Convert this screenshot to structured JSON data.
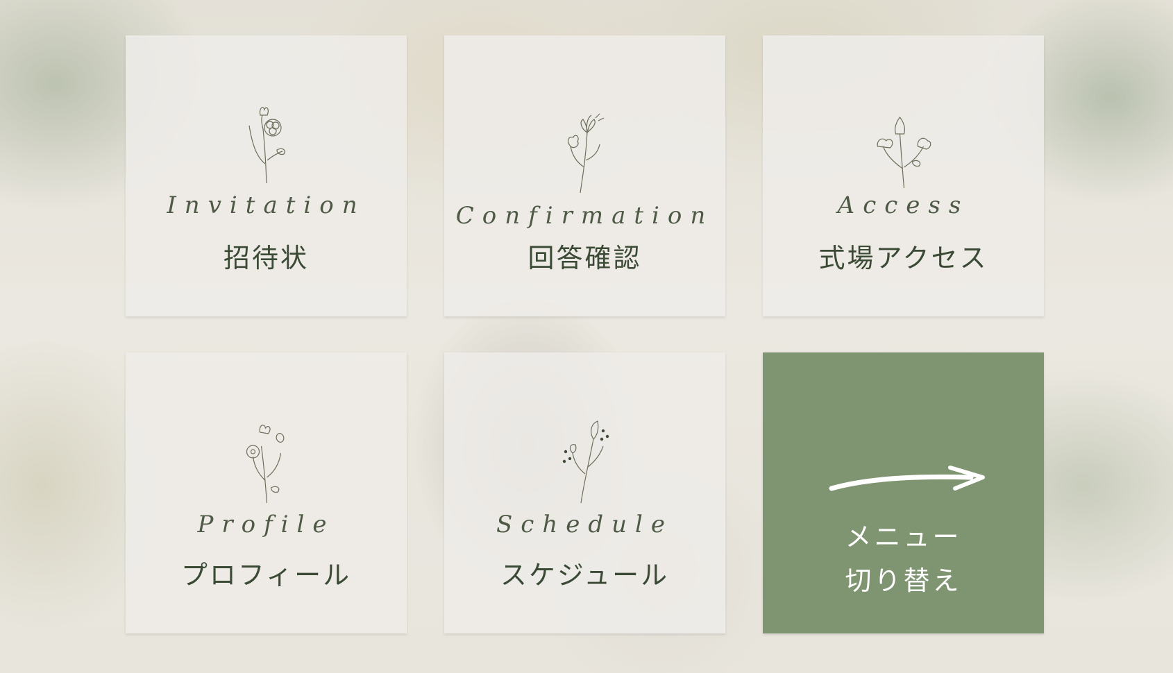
{
  "menu": {
    "tiles": [
      {
        "script": "Invitation",
        "label": "招待状"
      },
      {
        "script": "Confirmation",
        "label": "回答確認"
      },
      {
        "script": "Access",
        "label": "式場アクセス"
      },
      {
        "script": "Profile",
        "label": "プロフィール"
      },
      {
        "script": "Schedule",
        "label": "スケジュール"
      }
    ],
    "switch": {
      "line1": "メニュー",
      "line2": "切り替え",
      "icon": "right-arrow-icon"
    }
  },
  "colors": {
    "accent_green": "#7f9470",
    "text_green": "#3a4a35",
    "tile_bg": "#eeece8"
  }
}
